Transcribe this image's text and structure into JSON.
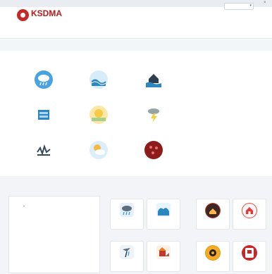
{
  "topbar": {
    "notice": "",
    "close": "×"
  },
  "brand": {
    "name": "KSDMA",
    "subtitle": ""
  },
  "nav": {
    "items": [
      {
        "label": "",
        "active": true
      },
      {
        "label": ""
      },
      {
        "label": ""
      },
      {
        "label": ""
      },
      {
        "label": ""
      },
      {
        "label": ""
      },
      {
        "label": ""
      },
      {
        "label": ""
      },
      {
        "label": ""
      }
    ]
  },
  "subnav": {
    "text": "",
    "select": ""
  },
  "hazards": {
    "title": "",
    "items": [
      {
        "label": "",
        "icon": "rain-cloud-icon",
        "color": "#4aa3df"
      },
      {
        "label": "",
        "icon": "wave-icon",
        "color": "#5dade2"
      },
      {
        "label": "",
        "icon": "flood-icon",
        "color": "#2c3e50"
      },
      {
        "label": "",
        "icon": "dam-icon",
        "color": "#2e86c1"
      },
      {
        "label": "",
        "icon": "sun-heat-icon",
        "color": "#f7c948"
      },
      {
        "label": "",
        "icon": "lightning-icon",
        "color": "#7f8c8d"
      },
      {
        "label": "",
        "icon": "earthquake-icon",
        "color": "#34495e"
      },
      {
        "label": "",
        "icon": "weather-icon",
        "color": "#f4b942"
      },
      {
        "label": "",
        "icon": "virus-icon",
        "color": "#8e1b1b"
      }
    ]
  },
  "news": {
    "title": "",
    "items": [
      "",
      ""
    ]
  },
  "messages": {
    "title": "",
    "link": "",
    "body": ""
  },
  "warnings": {
    "title": "",
    "tiles": [
      {
        "label": "",
        "icon": "rain-icon",
        "color": "#e6f0fa"
      },
      {
        "label": "",
        "icon": "wave-icon",
        "color": "#e6f4fb"
      },
      {
        "label": "",
        "icon": "cyclone-icon",
        "color": "#eef3f7"
      },
      {
        "label": "",
        "icon": "landslide-icon",
        "color": "#fdf1ea"
      }
    ]
  },
  "projects": {
    "title": "",
    "items": [
      {
        "label": "",
        "icon": "flood-shelter-icon",
        "color": "#c0392b"
      },
      {
        "label": "",
        "icon": "safe-home-icon",
        "color": "#e74c3c"
      },
      {
        "label": "",
        "icon": "ndma-icon",
        "color": "#d4a017"
      },
      {
        "label": "",
        "icon": "aapda-mitra-icon",
        "color": "#c62828"
      }
    ]
  }
}
